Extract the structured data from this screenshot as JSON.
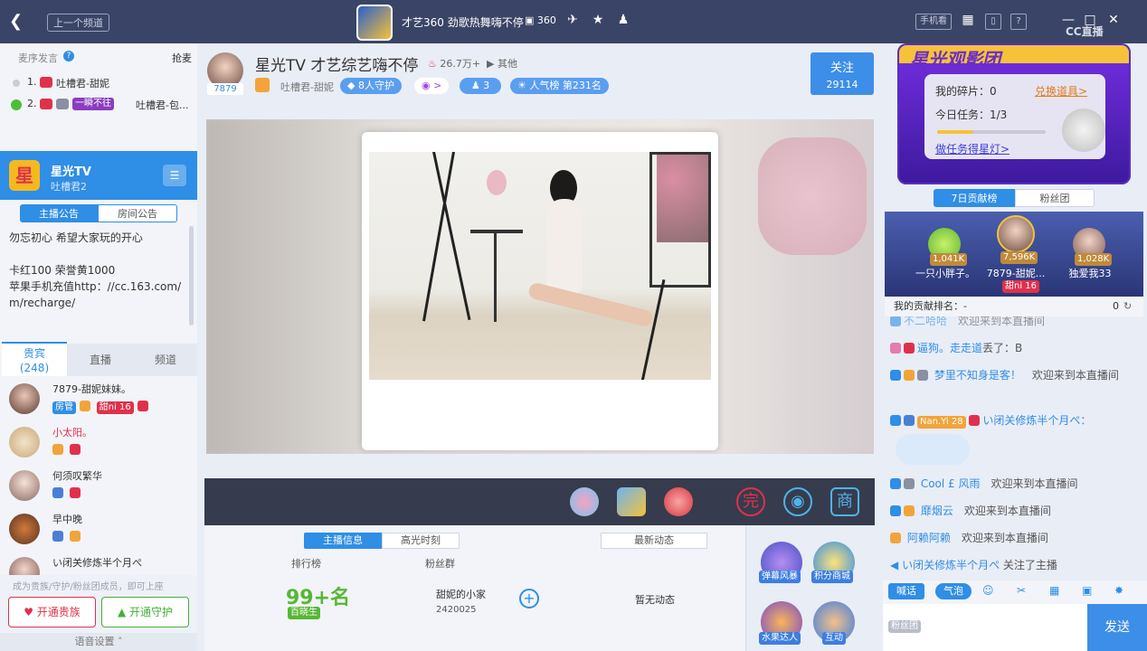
{
  "titlebar": {
    "back_icon": "chevron-left-icon",
    "prev_channel": "上一个频道",
    "room_title": "才艺360 劲歌热舞嗨不停",
    "room_id": "360",
    "phone_btn": "手机看",
    "window_controls": [
      "grid-icon",
      "bell-icon",
      "help-icon",
      "minimize-icon",
      "maximize-icon",
      "close-icon"
    ],
    "brand": "CC直播"
  },
  "mic_queue": {
    "label": "麦序发言",
    "grab": "抢麦",
    "items": [
      {
        "num": "1.",
        "name": "吐槽君-甜妮"
      },
      {
        "num": "2.",
        "tag": "一瞬不往",
        "name": "吐槽君-包..."
      }
    ]
  },
  "anchor_card": {
    "name": "星光TV",
    "sub": "吐槽君2",
    "tabs": [
      "主播公告",
      "房间公告"
    ],
    "notice_lines": [
      "勿忘初心 希望大家玩的开心",
      "",
      "卡红100  荣誉黄1000",
      "苹果手机充值http：//cc.163.com/",
      "m/recharge/"
    ]
  },
  "user_tabs": [
    {
      "label": "贵宾",
      "count": "(248)"
    },
    {
      "label": "直播"
    },
    {
      "label": "频道"
    }
  ],
  "users": [
    {
      "name": "7879-甜妮妹妹。",
      "badges": [
        "房管",
        "甜ni 16"
      ],
      "color": "#333"
    },
    {
      "name": "小太阳。",
      "color": "#e0314b"
    },
    {
      "name": "何须叹繁华",
      "color": "#333"
    },
    {
      "name": "早中晚",
      "color": "#333"
    },
    {
      "name": "い闭关修炼半个月ぺ",
      "color": "#333"
    }
  ],
  "left_footer": {
    "hint": "成为贵族/守护/粉丝团成员，即可上座",
    "btn_noble": "开通贵族",
    "btn_guard": "开通守护",
    "voice_settings": "语音设置"
  },
  "room_header": {
    "anchor_id": "7879",
    "title": "星光TV 才艺综艺嗨不停",
    "heat": "26.7万+",
    "more": "其他",
    "streamer_name": "吐槽君-甜妮",
    "guards": "8人守护",
    "fans_badge": ">",
    "fans_count": "3",
    "rank": "人气榜 第231名",
    "follow_label": "关注",
    "follow_count": "29114"
  },
  "info_tabs": [
    "主播信息",
    "高光时刻"
  ],
  "info": {
    "rank_label": "排行榜",
    "rank_value": "99+名",
    "rank_tag": "百晓生",
    "fans_label": "粉丝群",
    "fans_group": "甜妮的小家",
    "fans_group_id": "2420025",
    "news_tab": "最新动态",
    "news_empty": "暂无动态"
  },
  "side_apps": [
    {
      "label": "弹幕风暴"
    },
    {
      "label": "积分商城"
    },
    {
      "label": "水果达人"
    },
    {
      "label": "互动"
    }
  ],
  "promo": {
    "title": "星光观影团",
    "fragments": "我的碎片：0",
    "redeem": "兑换道具>",
    "task": "今日任务：1/3",
    "task_link": "做任务得星灯>",
    "progress": 0.33
  },
  "rank_tabs": [
    "7日贡献榜",
    "粉丝团"
  ],
  "podium": [
    {
      "name": "一只小胖子。",
      "score": "1,041K"
    },
    {
      "name": "7879-甜妮...",
      "score": "7,596K",
      "badge": "甜ni 16"
    },
    {
      "name": "独爱我33",
      "score": "1,028K"
    }
  ],
  "my_rank": {
    "label": "我的贡献排名：",
    "value": "-",
    "score": "0"
  },
  "chat": [
    {
      "name": "不二哈哈",
      "msg": "欢迎来到本直播间"
    },
    {
      "name": "逼狗。走走道",
      "msg": "丢了：B"
    },
    {
      "name": "梦里不知身是客！",
      "msg": "欢迎来到本直播间"
    },
    {
      "name": "Nan.Yi 28",
      "msg": "い闭关修炼半个月ぺ："
    },
    {
      "name": "Cool £ 风雨",
      "msg": "欢迎来到本直播间"
    },
    {
      "name": "靡烟云",
      "msg": "欢迎来到本直播间"
    },
    {
      "name": "阿赖阿赖",
      "msg": "欢迎来到本直播间"
    },
    {
      "name": "い闭关修炼半个月ぺ",
      "msg": "关注了主播"
    }
  ],
  "chat_tools": [
    "喊话",
    "气泡"
  ],
  "input": {
    "fans_tag": "粉丝团",
    "send": "发送"
  }
}
